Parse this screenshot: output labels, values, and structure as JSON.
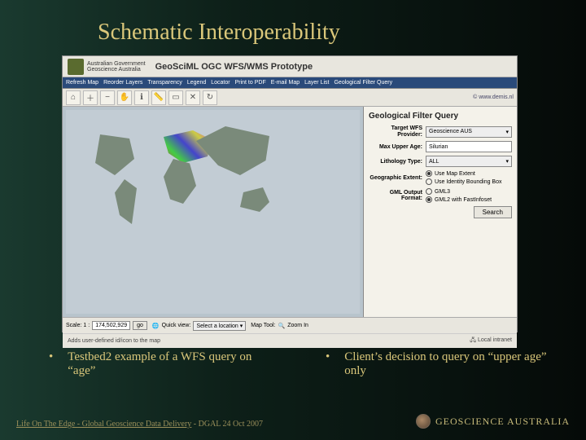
{
  "slide": {
    "title": "Schematic Interoperability",
    "bullets": [
      "Testbed2 example of a WFS query on “age”",
      "Client’s decision to query on “upper age” only"
    ],
    "footer_left": "Life On The Edge - Global Geoscience Data Delivery",
    "footer_suffix": " - DGAL 24 Oct 2007",
    "org": "GEOSCIENCE AUSTRALIA"
  },
  "app": {
    "gov_line1": "Australian Government",
    "gov_line2": "Geoscience Australia",
    "title": "GeoSciML OGC WFS/WMS Prototype",
    "credit": "© www.demis.nl",
    "menu": [
      "Refresh Map",
      "Reorder Layers",
      "Transparency",
      "Legend",
      "Locator",
      "Print to PDF",
      "E-mail Map",
      "Layer List",
      "Geological Filter Query"
    ],
    "status": {
      "scale_label": "Scale: 1 :",
      "scale_value": "174,502,929",
      "go": "go",
      "quickview_label": "Quick view:",
      "quickview_value": "Select a location",
      "maptool_label": "Map Tool:",
      "maptool_value": "Zoom In"
    },
    "addbar_left": "Adds user-defined id/icon to the map",
    "addbar_right": "Local intranet"
  },
  "panel": {
    "title": "Geological Filter Query",
    "provider_label": "Target WFS Provider:",
    "provider_value": "Geoscience AUS",
    "maxage_label": "Max Upper Age:",
    "maxage_value": "Silurian",
    "litho_label": "Lithology Type:",
    "litho_value": "ALL",
    "extent_label": "Geographic Extent:",
    "extent_opt1": "Use Map Extent",
    "extent_opt2": "Use Identity Bounding Box",
    "gml_label": "GML Output Format:",
    "gml_opt1": "GML3",
    "gml_opt2": "GML2 with FastInfoset",
    "search": "Search"
  }
}
